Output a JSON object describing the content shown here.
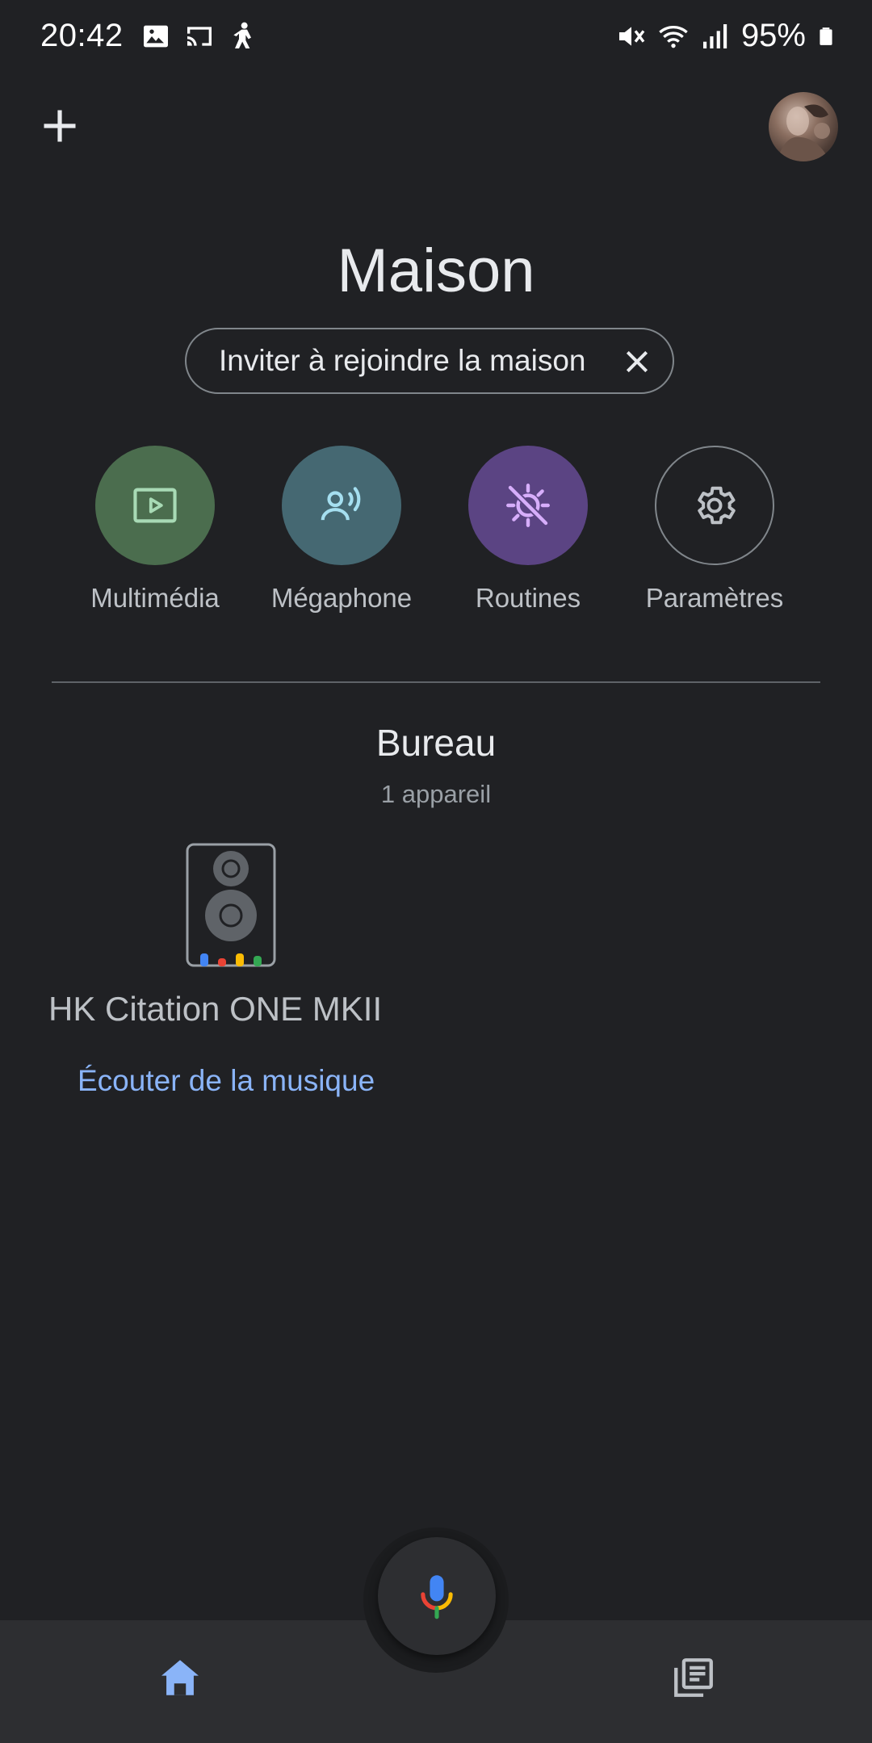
{
  "status_bar": {
    "time": "20:42",
    "battery": "95%",
    "icons_left": [
      "image-icon",
      "cast-icon",
      "figure-icon"
    ],
    "icons_right": [
      "mute-icon",
      "wifi-icon",
      "signal-icon",
      "battery-icon"
    ]
  },
  "header": {
    "add_icon": "plus-icon",
    "avatar": "profile-avatar"
  },
  "home": {
    "title": "Maison",
    "invite_label": "Inviter à rejoindre la maison"
  },
  "actions": [
    {
      "label": "Multimédia",
      "icon": "play-icon",
      "color": "#4b6d4e",
      "icon_color": "#a8dab5"
    },
    {
      "label": "Mégaphone",
      "icon": "broadcast-icon",
      "color": "#456872",
      "icon_color": "#a5dff0"
    },
    {
      "label": "Routines",
      "icon": "routine-icon",
      "color": "#5b4483",
      "icon_color": "#d7aefb"
    },
    {
      "label": "Paramètres",
      "icon": "gear-icon",
      "color": "#202124",
      "icon_color": "#bdc1c6"
    }
  ],
  "room": {
    "name": "Bureau",
    "count": "1 appareil",
    "device_name": "HK Citation ONE MKII",
    "device_action": "Écouter de la musique"
  },
  "colors": {
    "background": "#202124",
    "accent": "#8ab4f8",
    "nav_bg": "#2d2e31"
  },
  "nav": {
    "home_icon": "home-icon",
    "feed_icon": "feed-icon",
    "mic_icon": "mic-icon"
  }
}
